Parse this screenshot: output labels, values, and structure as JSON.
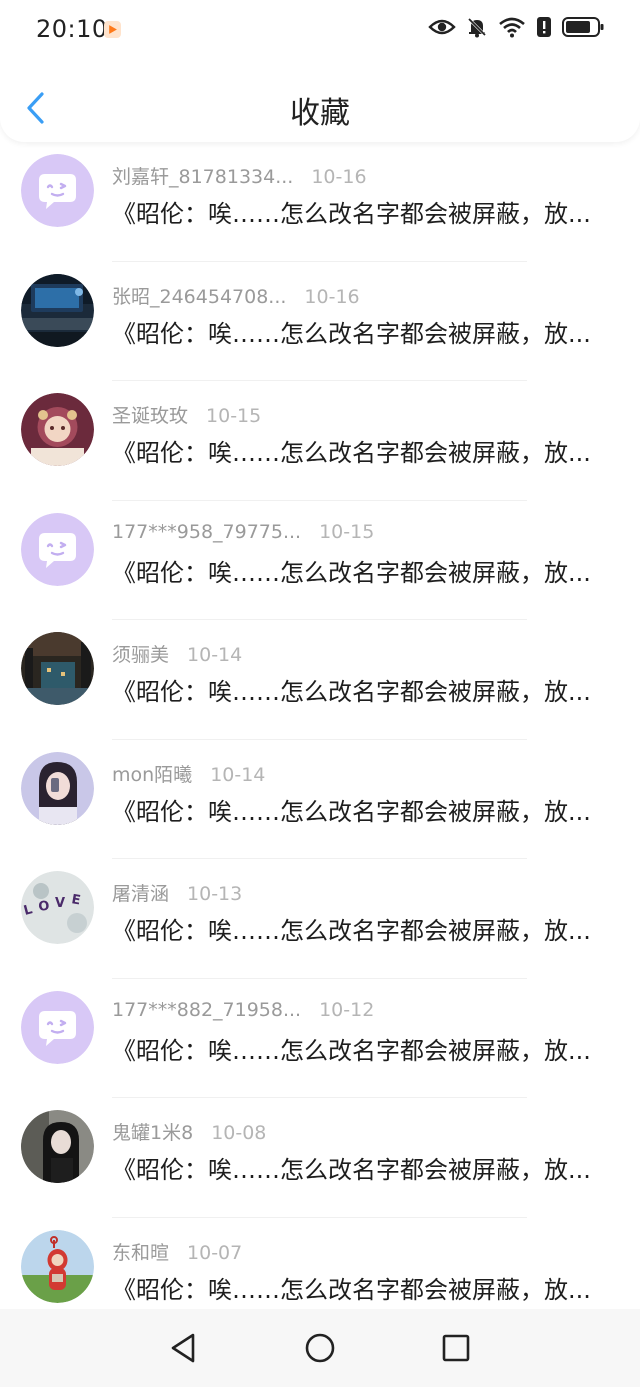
{
  "status_bar": {
    "time": "20:10",
    "icons": [
      "app-notification-icon",
      "eye-icon",
      "bell-muted-icon",
      "wifi-icon",
      "alert-icon",
      "battery-icon"
    ]
  },
  "header": {
    "title": "收藏",
    "back_icon": "back-arrow-icon"
  },
  "items": [
    {
      "name": "刘嘉轩_81781334...",
      "date": "10-16",
      "message": "《昭伦：唉……怎么改名字都会被屏蔽，放...",
      "avatar": "default-chat-avatar"
    },
    {
      "name": "张昭_246454708...",
      "date": "10-16",
      "message": "《昭伦：唉……怎么改名字都会被屏蔽，放...",
      "avatar": "desk-setup-photo"
    },
    {
      "name": "圣诞玫玫",
      "date": "10-15",
      "message": "《昭伦：唉……怎么改名字都会被屏蔽，放...",
      "avatar": "cartoon-girl-photo"
    },
    {
      "name": "177***958_79775...",
      "date": "10-15",
      "message": "《昭伦：唉……怎么改名字都会被屏蔽，放...",
      "avatar": "default-chat-avatar"
    },
    {
      "name": "须骊美",
      "date": "10-14",
      "message": "《昭伦：唉……怎么改名字都会被屏蔽，放...",
      "avatar": "city-photo"
    },
    {
      "name": "mon陌曦",
      "date": "10-14",
      "message": "《昭伦：唉……怎么改名字都会被屏蔽，放...",
      "avatar": "girl-selfie-photo"
    },
    {
      "name": "屠清涵",
      "date": "10-13",
      "message": "《昭伦：唉……怎么改名字都会被屏蔽，放...",
      "avatar": "love-letters-photo"
    },
    {
      "name": "177***882_71958...",
      "date": "10-12",
      "message": "《昭伦：唉……怎么改名字都会被屏蔽，放...",
      "avatar": "default-chat-avatar"
    },
    {
      "name": "鬼罐1米8",
      "date": "10-08",
      "message": "《昭伦：唉……怎么改名字都会被屏蔽，放...",
      "avatar": "dark-hair-girl-photo"
    },
    {
      "name": "东和暄",
      "date": "10-07",
      "message": "《昭伦：唉……怎么改名字都会被屏蔽，放...",
      "avatar": "teletubby-photo"
    }
  ],
  "nav_bar": {
    "back": "triangle-back-icon",
    "home": "circle-home-icon",
    "recents": "square-recents-icon"
  }
}
